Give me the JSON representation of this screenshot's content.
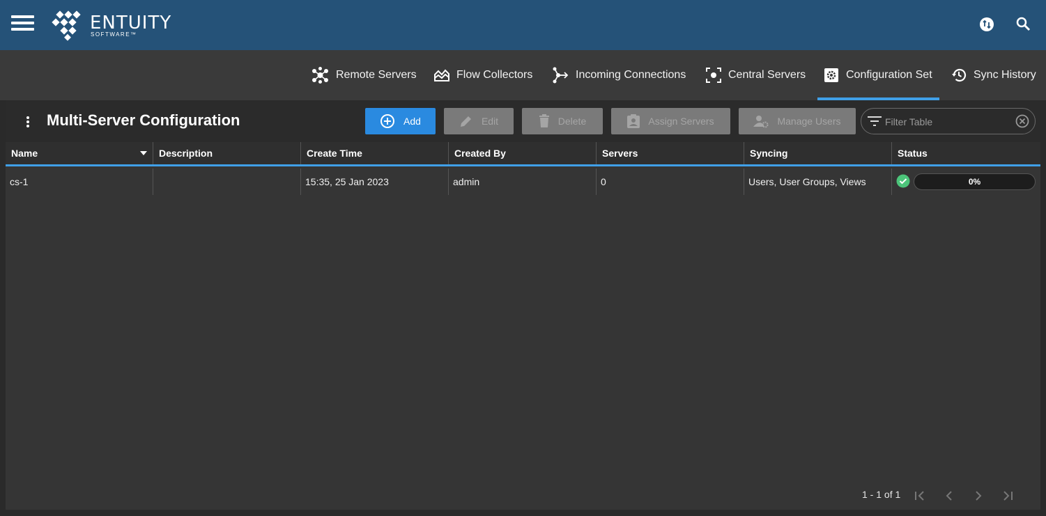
{
  "brand": {
    "name": "ENTUITY",
    "sub": "SOFTWARE™"
  },
  "header_icons": [
    "sync-icon",
    "search-icon"
  ],
  "tabs": [
    {
      "label": "Remote Servers",
      "icon": "hub-icon"
    },
    {
      "label": "Flow Collectors",
      "icon": "flow-icon"
    },
    {
      "label": "Incoming Connections",
      "icon": "incoming-icon"
    },
    {
      "label": "Central Servers",
      "icon": "central-icon"
    },
    {
      "label": "Configuration Set",
      "icon": "gear-icon",
      "active": true
    },
    {
      "label": "Sync History",
      "icon": "history-icon"
    }
  ],
  "page": {
    "title": "Multi-Server Configuration"
  },
  "toolbar": {
    "add": "Add",
    "edit": "Edit",
    "delete": "Delete",
    "assign": "Assign Servers",
    "manage": "Manage Users",
    "filter_placeholder": "Filter Table"
  },
  "table": {
    "columns": [
      "Name",
      "Description",
      "Create Time",
      "Created By",
      "Servers",
      "Syncing",
      "Status"
    ],
    "sort_column": "Name",
    "rows": [
      {
        "name": "cs-1",
        "description": "",
        "create_time": "15:35, 25 Jan 2023",
        "created_by": "admin",
        "servers": "0",
        "syncing": "Users, User Groups, Views",
        "status": "ok",
        "progress": "0%"
      }
    ]
  },
  "pagination": {
    "text": "1 - 1 of 1"
  },
  "colors": {
    "header": "#255278",
    "accent": "#40a0e8",
    "primary_button": "#2a8ae0",
    "status_ok": "#4cc47a"
  }
}
